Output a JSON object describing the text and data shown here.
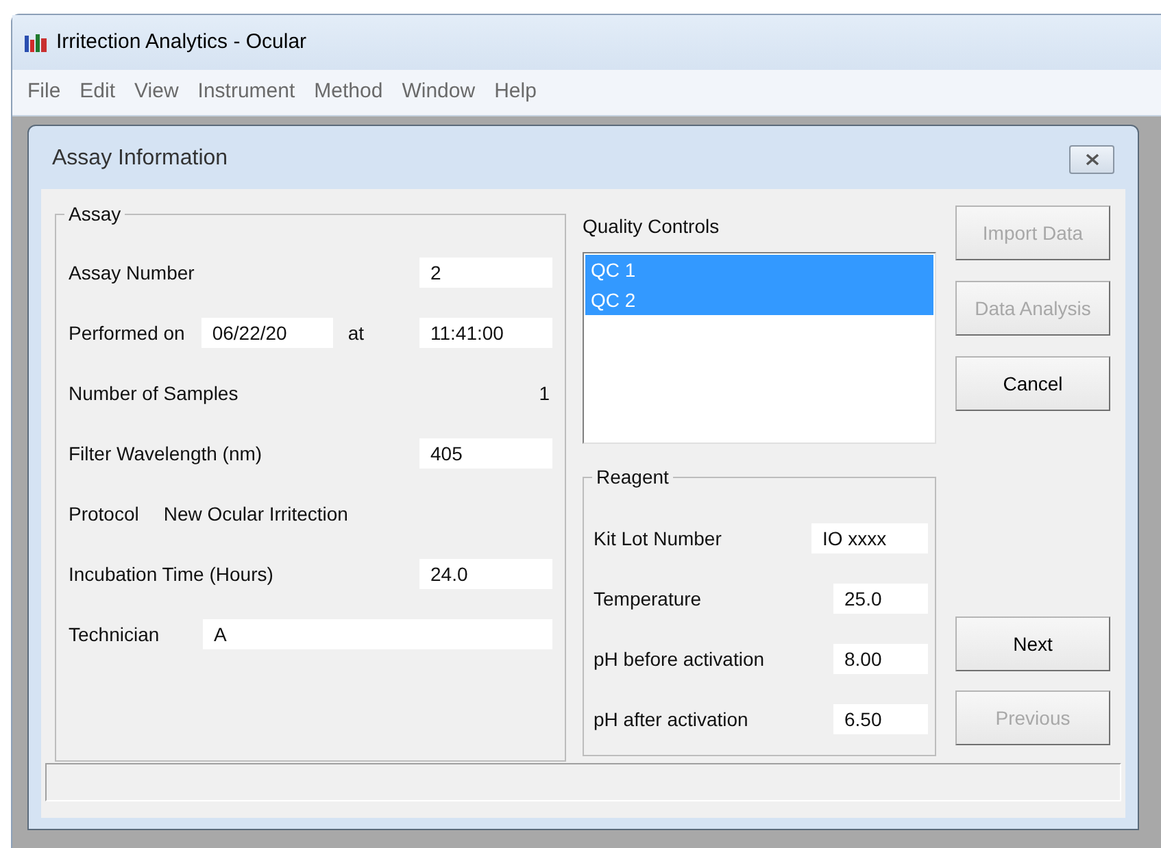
{
  "window": {
    "title": "Irritection Analytics - Ocular"
  },
  "menu": [
    "File",
    "Edit",
    "View",
    "Instrument",
    "Method",
    "Window",
    "Help"
  ],
  "dialog": {
    "title": "Assay Information",
    "assay": {
      "title": "Assay",
      "rows": [
        {
          "kind": "field",
          "label": "Assay Number",
          "value": "2"
        },
        {
          "kind": "datetime",
          "label": "Performed on",
          "date": "06/22/20",
          "at": "at",
          "time": "11:41:00"
        },
        {
          "kind": "readout",
          "label": "Number of Samples",
          "value": "1"
        },
        {
          "kind": "field",
          "label": "Filter Wavelength (nm)",
          "value": "405"
        },
        {
          "kind": "text",
          "label": "Protocol",
          "value": "New Ocular Irritection"
        },
        {
          "kind": "field",
          "label": "Incubation Time (Hours)",
          "value": "24.0"
        },
        {
          "kind": "wide",
          "label": "Technician",
          "value": "A"
        }
      ]
    },
    "quality_controls": {
      "label": "Quality Controls",
      "items": [
        {
          "text": "QC 1",
          "selected": true
        },
        {
          "text": "QC 2",
          "selected": true
        }
      ]
    },
    "reagent": {
      "title": "Reagent",
      "rows": [
        {
          "label": "Kit Lot Number",
          "value": "IO xxxx"
        },
        {
          "label": "Temperature",
          "value": "25.0"
        },
        {
          "label": "pH before activation",
          "value": "8.00"
        },
        {
          "label": "pH after activation",
          "value": "6.50"
        }
      ]
    },
    "top_buttons": [
      {
        "label": "Import Data",
        "disabled": true
      },
      {
        "label": "Data Analysis",
        "disabled": true
      },
      {
        "label": "Cancel",
        "disabled": false
      }
    ],
    "bottom_buttons": [
      {
        "label": "Next",
        "disabled": false
      },
      {
        "label": "Previous",
        "disabled": true
      }
    ]
  }
}
